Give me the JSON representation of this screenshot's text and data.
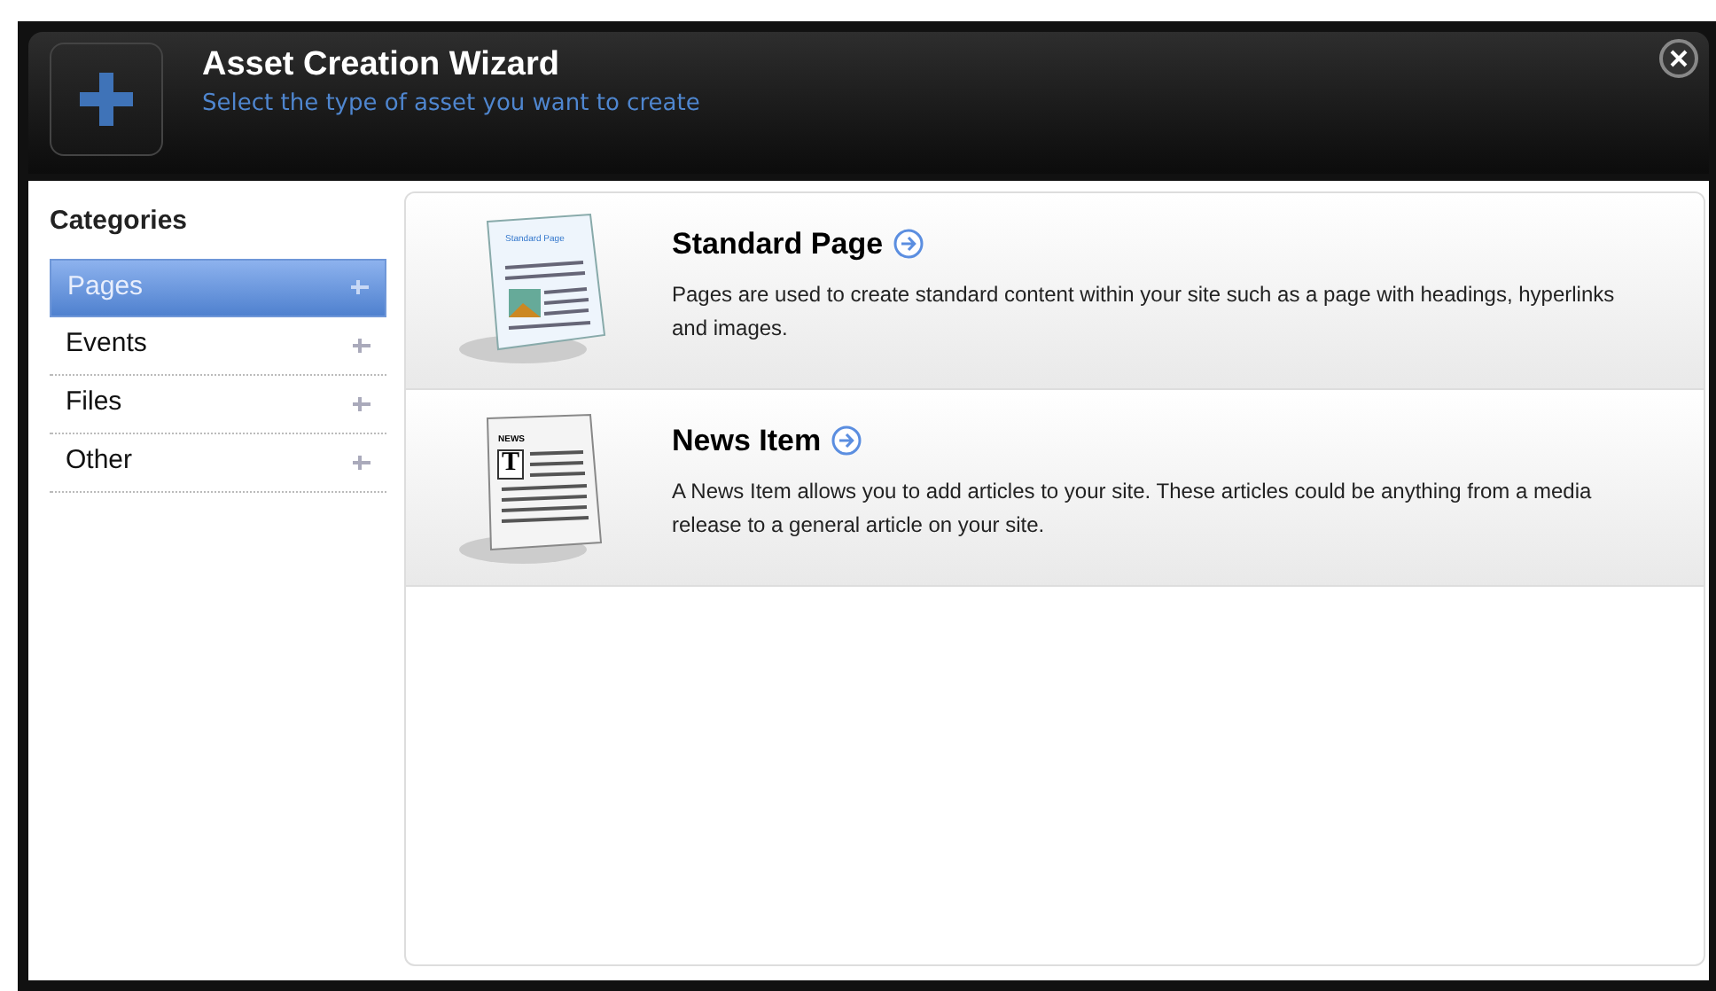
{
  "dialog": {
    "title": "Asset Creation Wizard",
    "subtitle": "Select the type of asset you want to create"
  },
  "sidebar": {
    "heading": "Categories",
    "items": [
      {
        "label": "Pages",
        "selected": true
      },
      {
        "label": "Events",
        "selected": false
      },
      {
        "label": "Files",
        "selected": false
      },
      {
        "label": "Other",
        "selected": false
      }
    ]
  },
  "assets": [
    {
      "kind": "page",
      "title": "Standard Page",
      "icon_caption": "Standard Page",
      "description": "Pages are used to create standard content within your site such as a page with headings, hyperlinks and images."
    },
    {
      "kind": "news",
      "title": "News Item",
      "icon_caption": "NEWS",
      "icon_letter": "T",
      "description": "A News Item allows you to add articles to your site. These articles could be anything from a media release to a general article on your site."
    }
  ]
}
